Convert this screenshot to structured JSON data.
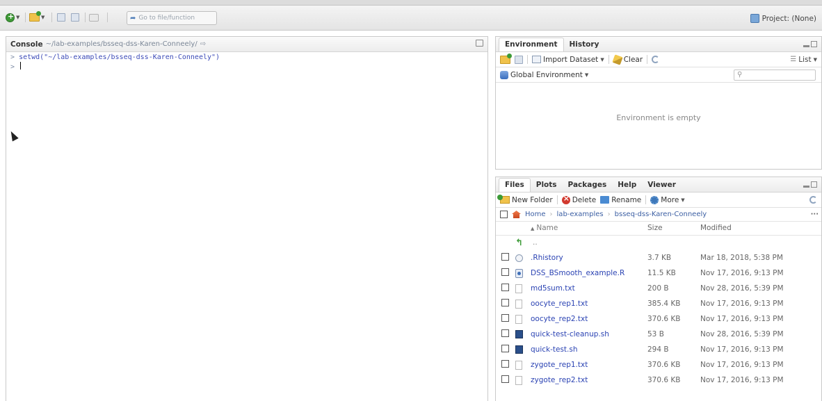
{
  "toolbar": {
    "goto_placeholder": "Go to file/function",
    "project_label": "Project: (None)"
  },
  "console": {
    "title": "Console",
    "path": "~/lab-examples/bsseq-dss-Karen-Conneely/",
    "lines": [
      {
        "prompt": ">",
        "text": "setwd(\"~/lab-examples/bsseq-dss-Karen-Conneely\")"
      },
      {
        "prompt": ">",
        "text": ""
      }
    ]
  },
  "environment_pane": {
    "tabs": [
      "Environment",
      "History"
    ],
    "import_label": "Import Dataset",
    "clear_label": "Clear",
    "list_label": "List",
    "scope_label": "Global Environment",
    "empty_message": "Environment is empty"
  },
  "files_pane": {
    "tabs": [
      "Files",
      "Plots",
      "Packages",
      "Help",
      "Viewer"
    ],
    "new_folder_label": "New Folder",
    "delete_label": "Delete",
    "rename_label": "Rename",
    "more_label": "More",
    "breadcrumb": [
      "Home",
      "lab-examples",
      "bsseq-dss-Karen-Conneely"
    ],
    "columns": {
      "name": "Name",
      "size": "Size",
      "modified": "Modified"
    },
    "parent_label": "..",
    "files": [
      {
        "name": ".Rhistory",
        "size": "3.7 KB",
        "modified": "Mar 18, 2018, 5:38 PM",
        "icon": "rhistory-icon"
      },
      {
        "name": "DSS_BSmooth_example.R",
        "size": "11.5 KB",
        "modified": "Nov 17, 2016, 9:13 PM",
        "icon": "r-script-icon"
      },
      {
        "name": "md5sum.txt",
        "size": "200 B",
        "modified": "Nov 28, 2016, 5:39 PM",
        "icon": "text-file-icon"
      },
      {
        "name": "oocyte_rep1.txt",
        "size": "385.4 KB",
        "modified": "Nov 17, 2016, 9:13 PM",
        "icon": "text-file-icon"
      },
      {
        "name": "oocyte_rep2.txt",
        "size": "370.6 KB",
        "modified": "Nov 17, 2016, 9:13 PM",
        "icon": "text-file-icon"
      },
      {
        "name": "quick-test-cleanup.sh",
        "size": "53 B",
        "modified": "Nov 28, 2016, 5:39 PM",
        "icon": "shell-script-icon"
      },
      {
        "name": "quick-test.sh",
        "size": "294 B",
        "modified": "Nov 17, 2016, 9:13 PM",
        "icon": "shell-script-icon"
      },
      {
        "name": "zygote_rep1.txt",
        "size": "370.6 KB",
        "modified": "Nov 17, 2016, 9:13 PM",
        "icon": "text-file-icon"
      },
      {
        "name": "zygote_rep2.txt",
        "size": "370.6 KB",
        "modified": "Nov 17, 2016, 9:13 PM",
        "icon": "text-file-icon"
      }
    ]
  }
}
